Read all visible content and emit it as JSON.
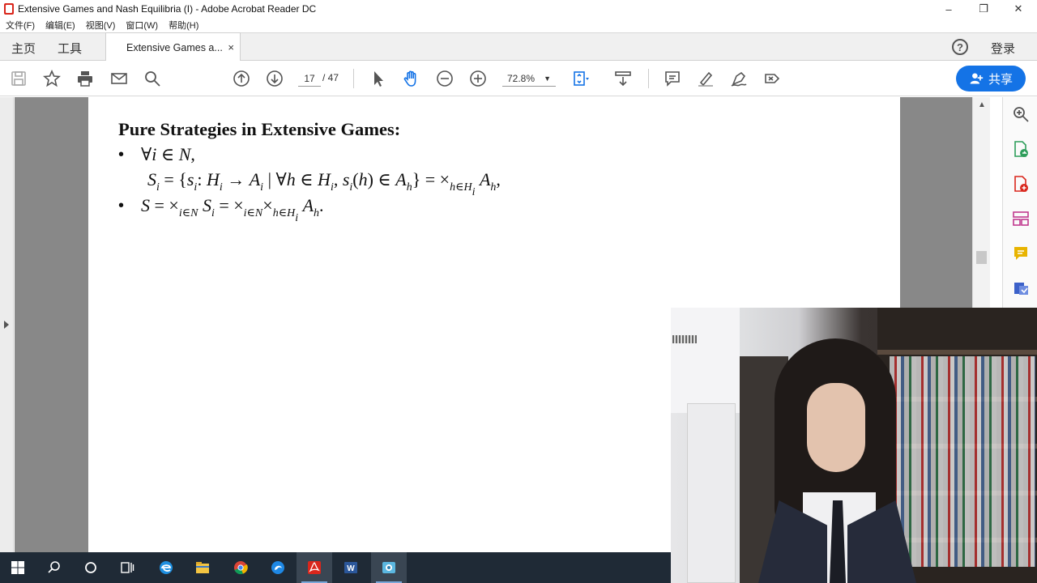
{
  "window": {
    "title": "Extensive Games and Nash Equilibria (I) - Adobe Acrobat Reader DC",
    "controls": {
      "minimize": "–",
      "restore": "❐",
      "close": "✕"
    }
  },
  "menu": [
    "文件(F)",
    "编辑(E)",
    "视图(V)",
    "窗口(W)",
    "帮助(H)"
  ],
  "tabs": {
    "home": "主页",
    "tools": "工具",
    "document": "Extensive Games a...",
    "close_glyph": "×",
    "help_glyph": "?",
    "login": "登录"
  },
  "toolbar": {
    "current_page": "17",
    "total_pages": "/ 47",
    "zoom": "72.8%",
    "share_label": "共享"
  },
  "document": {
    "heading": "Pure Strategies in Extensive Games:",
    "bullet_glyph": "•"
  },
  "taskbar": {
    "items": [
      "start-icon",
      "search-icon",
      "cortana-icon",
      "task-view-icon",
      "edge-icon",
      "file-explorer-icon",
      "chrome-icon",
      "app-icon",
      "acrobat-icon",
      "word-icon",
      "media-app-icon"
    ]
  },
  "colors": {
    "accent": "#1473e6",
    "acrobat_red": "#d9261c",
    "taskbar": "#1f2a36"
  }
}
